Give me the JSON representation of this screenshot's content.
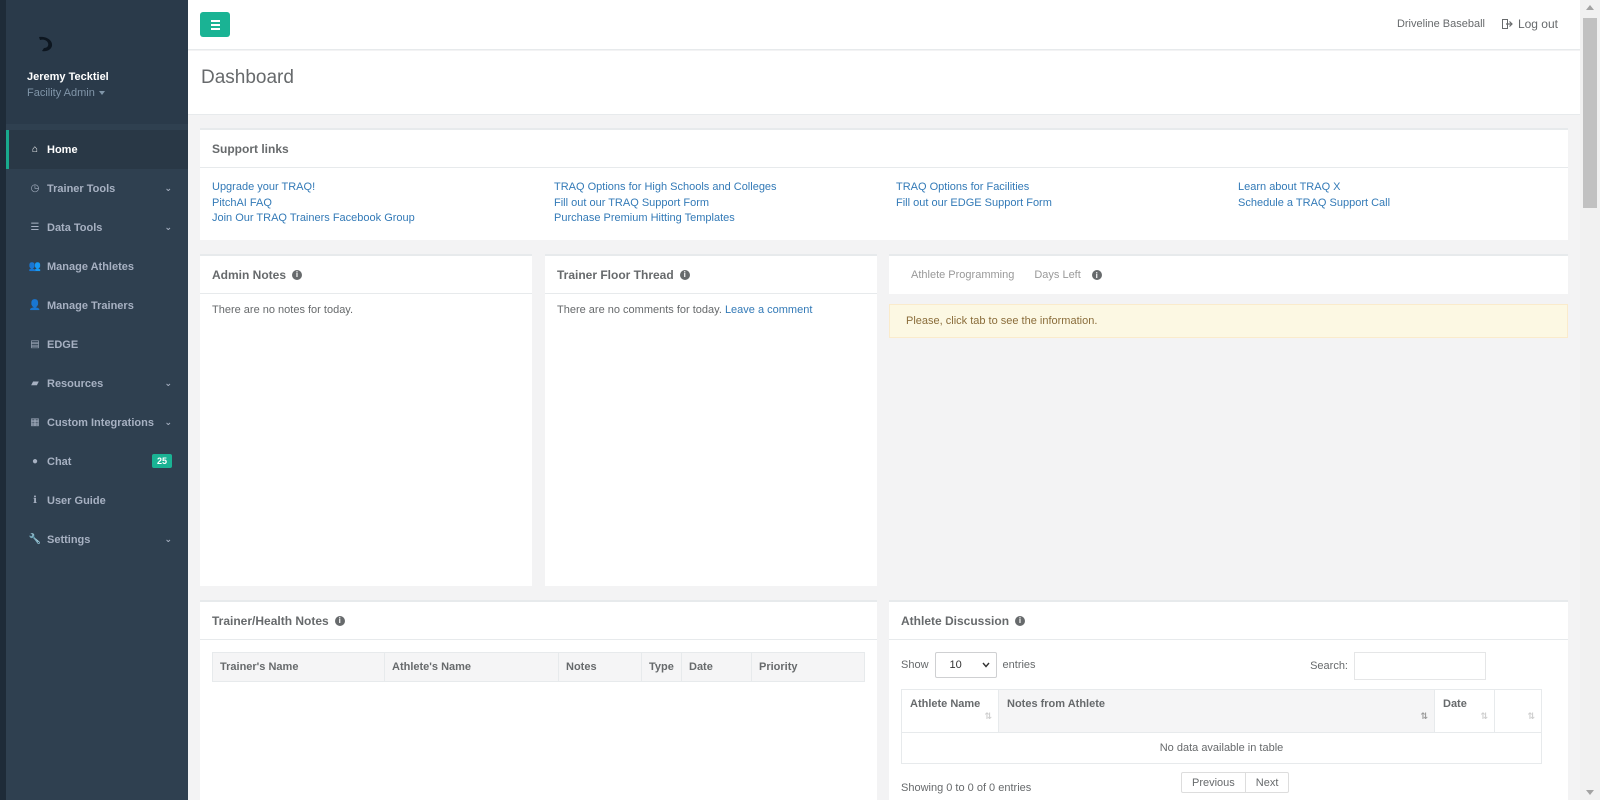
{
  "user": {
    "name": "Jeremy Tecktiel",
    "role": "Facility Admin"
  },
  "nav": [
    {
      "label": "Home",
      "icon": "home-icon",
      "glyph": "⌂",
      "active": true
    },
    {
      "label": "Trainer Tools",
      "icon": "clock-icon",
      "glyph": "◷",
      "chevron": true
    },
    {
      "label": "Data Tools",
      "icon": "list-icon",
      "glyph": "☰",
      "chevron": true
    },
    {
      "label": "Manage Athletes",
      "icon": "users-icon",
      "glyph": "👥"
    },
    {
      "label": "Manage Trainers",
      "icon": "user-plus-icon",
      "glyph": "👤"
    },
    {
      "label": "EDGE",
      "icon": "area-chart-icon",
      "glyph": "▤"
    },
    {
      "label": "Resources",
      "icon": "book-icon",
      "glyph": "▰",
      "chevron": true
    },
    {
      "label": "Custom Integrations",
      "icon": "grid-icon",
      "glyph": "▦",
      "chevron": true
    },
    {
      "label": "Chat",
      "icon": "comment-icon",
      "glyph": "●",
      "badge": "25"
    },
    {
      "label": "User Guide",
      "icon": "info-icon",
      "glyph": "ℹ"
    },
    {
      "label": "Settings",
      "icon": "wrench-icon",
      "glyph": "🔧",
      "chevron": true
    }
  ],
  "topbar": {
    "brand": "Driveline Baseball",
    "logout": "Log out"
  },
  "page_title": "Dashboard",
  "support": {
    "title": "Support links",
    "columns": [
      [
        "Upgrade your TRAQ!",
        "PitchAI FAQ",
        "Join Our TRAQ Trainers Facebook Group"
      ],
      [
        "TRAQ Options for High Schools and Colleges",
        "Fill out our TRAQ Support Form",
        "Purchase Premium Hitting Templates"
      ],
      [
        "TRAQ Options for Facilities",
        "Fill out our EDGE Support Form"
      ],
      [
        "Learn about TRAQ X",
        "Schedule a TRAQ Support Call"
      ]
    ]
  },
  "admin_notes": {
    "title": "Admin Notes",
    "empty": "There are no notes for today."
  },
  "trainer_thread": {
    "title": "Trainer Floor Thread",
    "empty": "There are no comments for today.",
    "link": "Leave a comment"
  },
  "programming": {
    "tabs": [
      "Athlete Programming",
      "Days Left"
    ],
    "alert": "Please, click tab to see the information."
  },
  "health_notes": {
    "title": "Trainer/Health Notes",
    "columns": [
      "Trainer's Name",
      "Athlete's Name",
      "Notes",
      "Type",
      "Date",
      "Priority"
    ]
  },
  "discussion": {
    "title": "Athlete Discussion",
    "show_label": "Show",
    "entries_value": "10",
    "entries_label": "entries",
    "search_label": "Search:",
    "columns": [
      "Athlete Name",
      "Notes from Athlete",
      "Date",
      ""
    ],
    "empty": "No data available in table",
    "info": "Showing 0 to 0 of 0 entries",
    "prev": "Previous",
    "next": "Next"
  }
}
